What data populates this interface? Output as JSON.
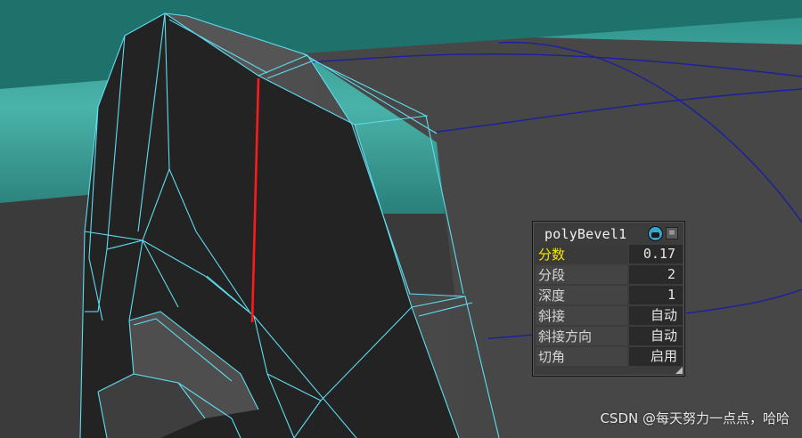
{
  "panel": {
    "title": "polyBevel1",
    "header_icon": "node-icon",
    "menu_icon": "menu-icon",
    "rows": [
      {
        "label": "分数",
        "value": "0.17",
        "active": true
      },
      {
        "label": "分段",
        "value": "2"
      },
      {
        "label": "深度",
        "value": "1"
      },
      {
        "label": "斜接",
        "value": "自动"
      },
      {
        "label": "斜接方向",
        "value": "自动"
      },
      {
        "label": "切角",
        "value": "启用"
      }
    ]
  },
  "watermark": "CSDN @每天努力一点点，哈哈",
  "colors": {
    "wireframe": "#5fdcf0",
    "selected_edge": "#ff1a1a",
    "active_label": "#f2e600",
    "background_teal": "#3aa89e",
    "navy_curve": "#1c1f9e"
  }
}
